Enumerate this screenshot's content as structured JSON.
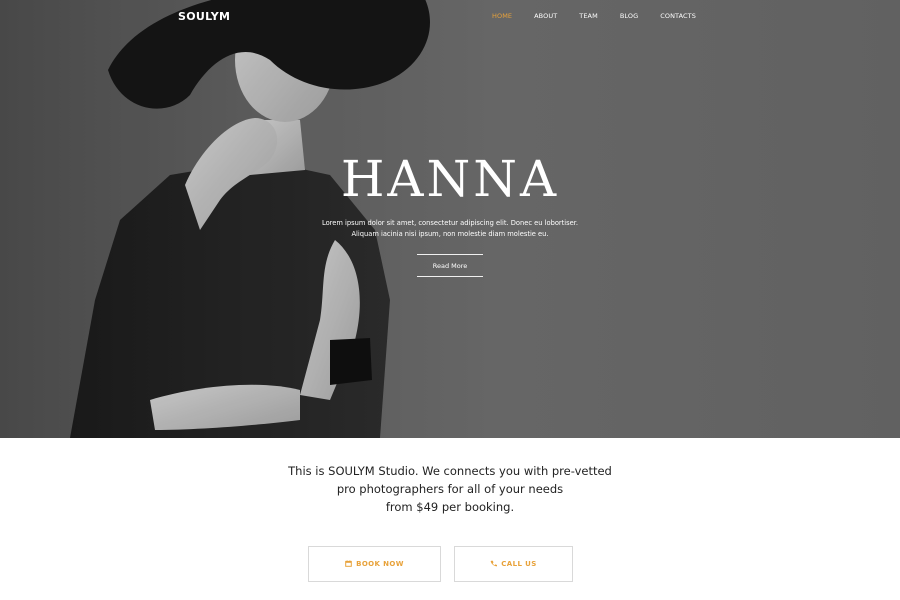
{
  "brand": {
    "logo": "SOULYM"
  },
  "nav": {
    "items": [
      {
        "label": "HOME",
        "active": true
      },
      {
        "label": "ABOUT",
        "active": false
      },
      {
        "label": "TEAM",
        "active": false
      },
      {
        "label": "BLOG",
        "active": false
      },
      {
        "label": "CONTACTS",
        "active": false
      }
    ]
  },
  "hero": {
    "title": "HANNA",
    "subtitle_line1": "Lorem ipsum dolor sit amet, consectetur adipiscing elit. Donec eu lobortiser.",
    "subtitle_line2": "Aliquam iacinia nisi ipsum, non molestie diam molestie eu.",
    "read_more": "Read More"
  },
  "intro": {
    "line1": "This is SOULYM Studio. We connects you with pre-vetted",
    "line2": "pro photographers for all of your needs",
    "line3": "from $49 per booking."
  },
  "actions": {
    "book": {
      "label": "BOOK NOW",
      "icon": "calendar-icon"
    },
    "call": {
      "label": "CALL US",
      "icon": "phone-icon"
    }
  },
  "colors": {
    "accent": "#e8a23a",
    "hero_background": "#666666",
    "text_dark": "#222222",
    "button_border": "#d9d9d9"
  }
}
